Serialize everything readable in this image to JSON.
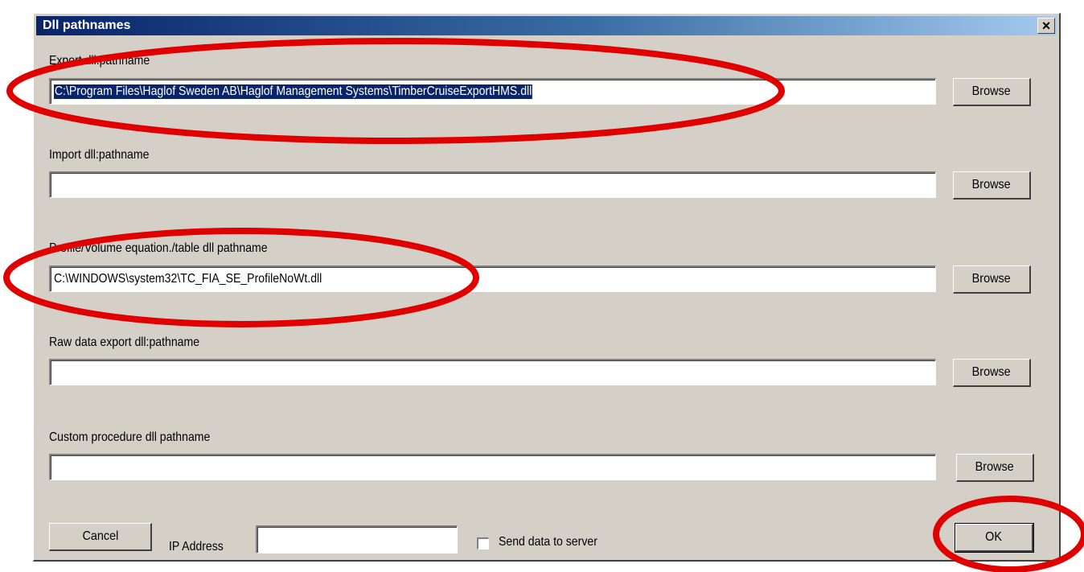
{
  "window": {
    "title": "Dll pathnames",
    "close_glyph": "×"
  },
  "fields": [
    {
      "label": "Export dll:pathname",
      "value": "C:\\Program Files\\Haglof Sweden AB\\Haglof Management Systems\\TimberCruiseExportHMS.dll",
      "button": "Browse"
    },
    {
      "label": "Import dll:pathname",
      "value": "",
      "button": "Browse"
    },
    {
      "label": "Profile/Volume equation./table dll pathname",
      "value": "C:\\WINDOWS\\system32\\TC_FIA_SE_ProfileNoWt.dll",
      "button": "Browse"
    },
    {
      "label": "Raw data export dll:pathname",
      "value": "",
      "button": "Browse"
    },
    {
      "label": "Custom procedure dll pathname",
      "value": "",
      "button": "Browse"
    }
  ],
  "footer": {
    "cancel_label": "Cancel",
    "ip_label": "IP Address",
    "ip_value": "",
    "send_label": "Send data to server",
    "send_checked": false,
    "ok_label": "OK"
  },
  "annotations": {
    "color": "#e00000"
  }
}
